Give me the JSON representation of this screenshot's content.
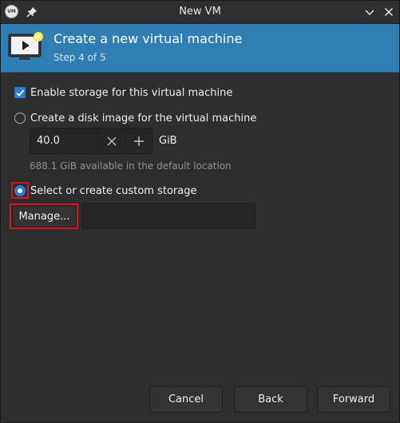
{
  "window": {
    "title": "New VM",
    "app_icon_text": "VM",
    "app_icon": "virt-manager-icon",
    "pin_icon": "pin-icon",
    "controls": [
      "chevron-down-icon",
      "close-icon"
    ]
  },
  "header": {
    "title": "Create a new virtual machine",
    "step": "Step 4 of 5",
    "icon": "new-vm-monitor-icon",
    "background_color": "#2f7fb5"
  },
  "storage": {
    "enable_label": "Enable storage for this virtual machine",
    "enable_checked": true,
    "create_disk_label": "Create a disk image for the virtual machine",
    "create_disk_selected": false,
    "disk_size": "40.0",
    "unit": "GiB",
    "available_text": "688.1 GiB available in the default location",
    "custom_label": "Select or create custom storage",
    "custom_selected": true,
    "manage_label": "Manage...",
    "path_value": ""
  },
  "buttons": {
    "cancel": "Cancel",
    "back": "Back",
    "forward": "Forward"
  },
  "colors": {
    "accent": "#2c7cd4",
    "highlight": "#d9141c",
    "window_bg": "#2e2e2e"
  }
}
